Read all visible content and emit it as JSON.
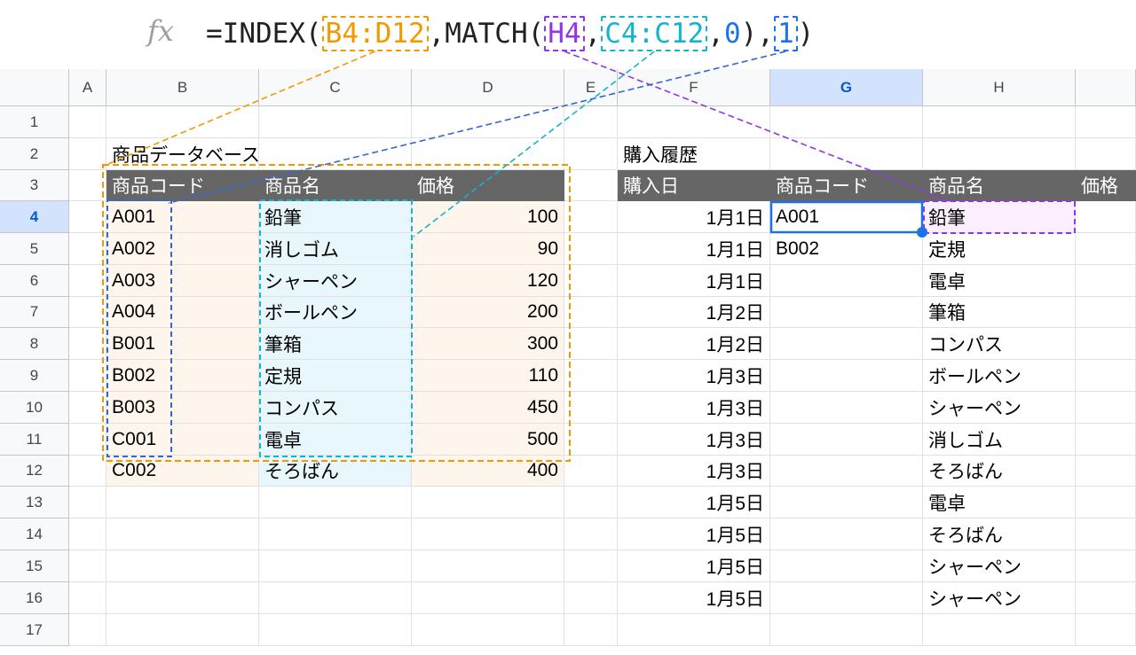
{
  "formula_bar": {
    "fx_icon": "fx-icon",
    "parts": [
      {
        "text": "=INDEX(",
        "style": "plain"
      },
      {
        "text": "B4:D12",
        "style": "orange"
      },
      {
        "text": ",MATCH(",
        "style": "plain"
      },
      {
        "text": "H4",
        "style": "purple"
      },
      {
        "text": ",",
        "style": "plain"
      },
      {
        "text": "C4:C12",
        "style": "cyan"
      },
      {
        "text": ",",
        "style": "plain"
      },
      {
        "text": "0",
        "style": "num"
      },
      {
        "text": "),",
        "style": "plain"
      },
      {
        "text": "1",
        "style": "blue"
      },
      {
        "text": ")",
        "style": "plain"
      }
    ]
  },
  "columns": [
    "A",
    "B",
    "C",
    "D",
    "E",
    "F",
    "G",
    "H",
    ""
  ],
  "selected_column": "G",
  "rows": [
    "1",
    "2",
    "3",
    "4",
    "5",
    "6",
    "7",
    "8",
    "9",
    "10",
    "11",
    "12",
    "13",
    "14",
    "15",
    "16",
    "17"
  ],
  "selected_row": "4",
  "colors": {
    "header_fill": "#666666",
    "index_range_fill": "#fef5ec",
    "match_range_fill": "#e8f7fc",
    "lookup_cell_fill": "#fcefff",
    "orange": "#f29900",
    "cyan": "#12b5cb",
    "blue": "#3367d6",
    "purple": "#9334e6",
    "active_border": "#1a73e8"
  },
  "cells": {
    "B2": "商品データベース",
    "B3": "商品コード",
    "C3": "商品名",
    "D3": "価格",
    "B4": "A001",
    "C4": "鉛筆",
    "D4": "100",
    "B5": "A002",
    "C5": "消しゴム",
    "D5": "90",
    "B6": "A003",
    "C6": "シャーペン",
    "D6": "120",
    "B7": "A004",
    "C7": "ボールペン",
    "D7": "200",
    "B8": "B001",
    "C8": "筆箱",
    "D8": "300",
    "B9": "B002",
    "C9": "定規",
    "D9": "110",
    "B10": "B003",
    "C10": "コンパス",
    "D10": "450",
    "B11": "C001",
    "C11": "電卓",
    "D11": "500",
    "B12": "C002",
    "C12": "そろばん",
    "D12": "400",
    "F2": "購入履歴",
    "F3": "購入日",
    "G3": "商品コード",
    "H3": "商品名",
    "I3": "価格",
    "F4": "1月1日",
    "G4": "A001",
    "H4": "鉛筆",
    "F5": "1月1日",
    "G5": "B002",
    "H5": "定規",
    "F6": "1月1日",
    "H6": "電卓",
    "F7": "1月2日",
    "H7": "筆箱",
    "F8": "1月2日",
    "H8": "コンパス",
    "F9": "1月3日",
    "H9": "ボールペン",
    "F10": "1月3日",
    "H10": "シャーペン",
    "F11": "1月3日",
    "H11": "消しゴム",
    "F12": "1月3日",
    "H12": "そろばん",
    "F13": "1月5日",
    "H13": "電卓",
    "F14": "1月5日",
    "H14": "そろばん",
    "F15": "1月5日",
    "H15": "シャーペン",
    "F16": "1月5日",
    "H16": "シャーペン"
  }
}
